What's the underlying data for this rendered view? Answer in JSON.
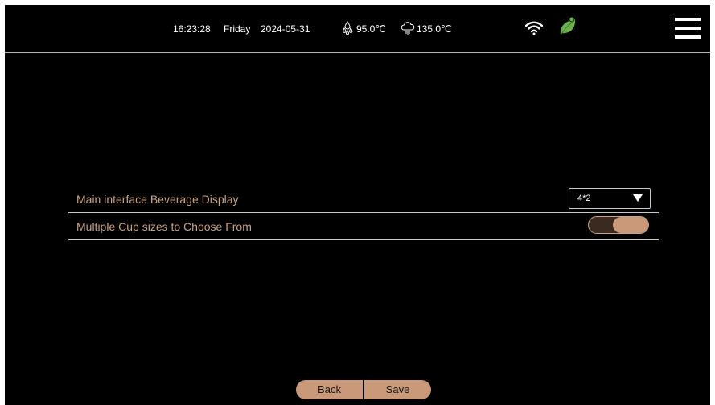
{
  "status_bar": {
    "time": "16:23:28",
    "day": "Friday",
    "date": "2024-05-31",
    "water_temp": "95.0℃",
    "steam_temp": "135.0℃",
    "icons": {
      "water": "water-drops-icon",
      "steam": "steam-cloud-icon",
      "wifi": "wifi-icon",
      "leaf": "eco-leaf-icon",
      "menu": "hamburger-menu-icon"
    }
  },
  "settings": {
    "display_label": "Main interface Beverage Display",
    "display_value": "4*2",
    "cup_sizes_label": "Multiple Cup sizes to Choose From",
    "cup_sizes_enabled": true
  },
  "buttons": {
    "back": "Back",
    "save": "Save"
  },
  "colors": {
    "background": "#000000",
    "accent": "#c9997a",
    "label_text": "#c9a27f",
    "leaf": "#6ab04c",
    "divider": "#c8c8c8"
  }
}
